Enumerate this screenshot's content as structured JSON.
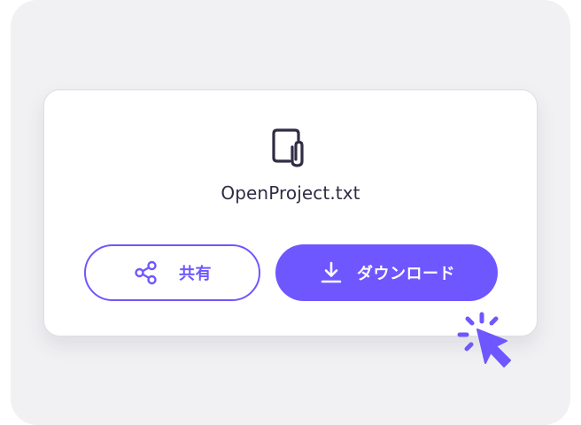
{
  "file": {
    "name": "OpenProject.txt",
    "icon": "file-attachment-icon"
  },
  "actions": {
    "share_label": "共有",
    "share_icon": "share-icon",
    "download_label": "ダウンロード",
    "download_icon": "download-icon"
  },
  "cursor": {
    "icon": "click-cursor-icon"
  },
  "colors": {
    "accent": "#6e57ff",
    "text": "#2f2d44",
    "frame_background": "#f1f1f3",
    "card_background": "#ffffff"
  }
}
